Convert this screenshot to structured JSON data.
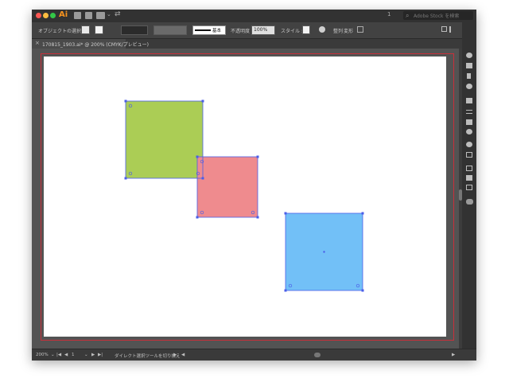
{
  "app": {
    "logo": "Ai"
  },
  "titlebar": {
    "workspace_number": "1",
    "search_placeholder": "Adobe Stock を検索",
    "traffic_colors": {
      "close": "#fc5753",
      "minimize": "#fdbc40",
      "zoom": "#33c748"
    }
  },
  "controlbar": {
    "selection_label": "オブジェクトの選択",
    "stroke_style": "基本",
    "opacity_label": "不透明度",
    "opacity_value": "100%",
    "style_label": "スタイル :",
    "align_label": "整列",
    "transform_label": "変形"
  },
  "document_tab": {
    "close_glyph": "×",
    "title": "170815_1903.ai* @ 200% (CMYK/プレビュー)"
  },
  "canvas": {
    "artboard_color": "#ffffff",
    "bleed_color": "#c8303b",
    "selection_color": "#4a5ee8",
    "shapes": [
      {
        "name": "green-square",
        "fill": "#abcd55"
      },
      {
        "name": "pink-square",
        "fill": "#ef8b8e"
      },
      {
        "name": "blue-square",
        "fill": "#72c0f7"
      }
    ]
  },
  "statusbar": {
    "zoom": "200%",
    "artboard_number": "1",
    "tool_hint": "ダイレクト選択ツールを切り換え"
  },
  "icons": [
    "close-icon",
    "search-icon",
    "bridge-icon",
    "stock-icon",
    "arrange-icon",
    "sync-icon",
    "fill-icon",
    "stroke-icon",
    "recolor-icon",
    "panel-toggle-icon"
  ]
}
